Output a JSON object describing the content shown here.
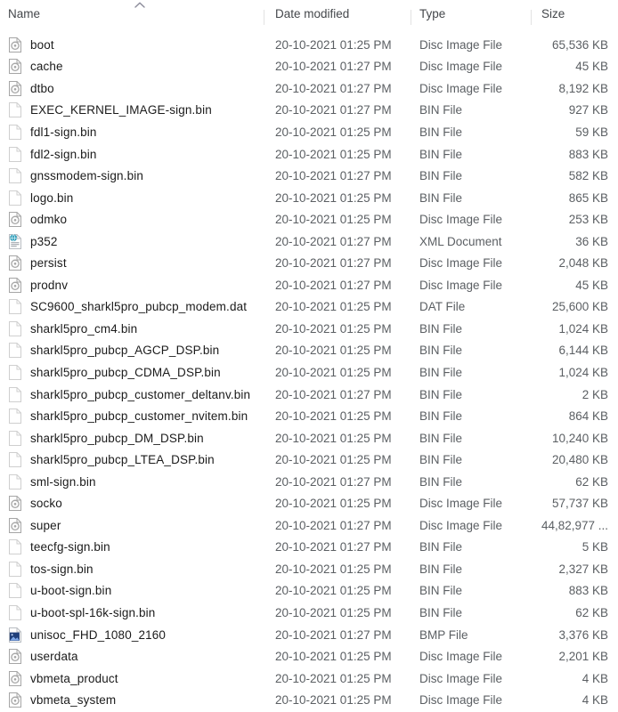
{
  "view": {
    "title": "File Explorer details view",
    "sort": {
      "column": "Name",
      "direction": "ascending",
      "indicator_icon": "chevron-up-icon"
    }
  },
  "columns": {
    "name": "Name",
    "date_modified": "Date modified",
    "type": "Type",
    "size": "Size"
  },
  "colors": {
    "text": "#1b1b1b",
    "secondary_text": "#5b5f63",
    "header_text": "#44474b",
    "divider": "#e2e2e2",
    "background": "#ffffff",
    "disc_icon": "#a6a6a6",
    "bin_icon": "#cfcfcf",
    "xml_icon": "#2b9cb8",
    "bmp_icon": "#1f3f7a"
  },
  "files": [
    {
      "name": "boot",
      "date": "20-10-2021 01:25 PM",
      "type": "Disc Image File",
      "size": "65,536 KB",
      "icon": "disc-image-file-icon"
    },
    {
      "name": "cache",
      "date": "20-10-2021 01:27 PM",
      "type": "Disc Image File",
      "size": "45 KB",
      "icon": "disc-image-file-icon"
    },
    {
      "name": "dtbo",
      "date": "20-10-2021 01:27 PM",
      "type": "Disc Image File",
      "size": "8,192 KB",
      "icon": "disc-image-file-icon"
    },
    {
      "name": "EXEC_KERNEL_IMAGE-sign.bin",
      "date": "20-10-2021 01:27 PM",
      "type": "BIN File",
      "size": "927 KB",
      "icon": "generic-file-icon"
    },
    {
      "name": "fdl1-sign.bin",
      "date": "20-10-2021 01:25 PM",
      "type": "BIN File",
      "size": "59 KB",
      "icon": "generic-file-icon"
    },
    {
      "name": "fdl2-sign.bin",
      "date": "20-10-2021 01:25 PM",
      "type": "BIN File",
      "size": "883 KB",
      "icon": "generic-file-icon"
    },
    {
      "name": "gnssmodem-sign.bin",
      "date": "20-10-2021 01:27 PM",
      "type": "BIN File",
      "size": "582 KB",
      "icon": "generic-file-icon"
    },
    {
      "name": "logo.bin",
      "date": "20-10-2021 01:25 PM",
      "type": "BIN File",
      "size": "865 KB",
      "icon": "generic-file-icon"
    },
    {
      "name": "odmko",
      "date": "20-10-2021 01:25 PM",
      "type": "Disc Image File",
      "size": "253 KB",
      "icon": "disc-image-file-icon"
    },
    {
      "name": "p352",
      "date": "20-10-2021 01:27 PM",
      "type": "XML Document",
      "size": "36 KB",
      "icon": "xml-document-icon"
    },
    {
      "name": "persist",
      "date": "20-10-2021 01:27 PM",
      "type": "Disc Image File",
      "size": "2,048 KB",
      "icon": "disc-image-file-icon"
    },
    {
      "name": "prodnv",
      "date": "20-10-2021 01:27 PM",
      "type": "Disc Image File",
      "size": "45 KB",
      "icon": "disc-image-file-icon"
    },
    {
      "name": "SC9600_sharkl5pro_pubcp_modem.dat",
      "date": "20-10-2021 01:25 PM",
      "type": "DAT File",
      "size": "25,600 KB",
      "icon": "generic-file-icon"
    },
    {
      "name": "sharkl5pro_cm4.bin",
      "date": "20-10-2021 01:25 PM",
      "type": "BIN File",
      "size": "1,024 KB",
      "icon": "generic-file-icon"
    },
    {
      "name": "sharkl5pro_pubcp_AGCP_DSP.bin",
      "date": "20-10-2021 01:25 PM",
      "type": "BIN File",
      "size": "6,144 KB",
      "icon": "generic-file-icon"
    },
    {
      "name": "sharkl5pro_pubcp_CDMA_DSP.bin",
      "date": "20-10-2021 01:25 PM",
      "type": "BIN File",
      "size": "1,024 KB",
      "icon": "generic-file-icon"
    },
    {
      "name": "sharkl5pro_pubcp_customer_deltanv.bin",
      "date": "20-10-2021 01:27 PM",
      "type": "BIN File",
      "size": "2 KB",
      "icon": "generic-file-icon"
    },
    {
      "name": "sharkl5pro_pubcp_customer_nvitem.bin",
      "date": "20-10-2021 01:25 PM",
      "type": "BIN File",
      "size": "864 KB",
      "icon": "generic-file-icon"
    },
    {
      "name": "sharkl5pro_pubcp_DM_DSP.bin",
      "date": "20-10-2021 01:25 PM",
      "type": "BIN File",
      "size": "10,240 KB",
      "icon": "generic-file-icon"
    },
    {
      "name": "sharkl5pro_pubcp_LTEA_DSP.bin",
      "date": "20-10-2021 01:25 PM",
      "type": "BIN File",
      "size": "20,480 KB",
      "icon": "generic-file-icon"
    },
    {
      "name": "sml-sign.bin",
      "date": "20-10-2021 01:27 PM",
      "type": "BIN File",
      "size": "62 KB",
      "icon": "generic-file-icon"
    },
    {
      "name": "socko",
      "date": "20-10-2021 01:25 PM",
      "type": "Disc Image File",
      "size": "57,737 KB",
      "icon": "disc-image-file-icon"
    },
    {
      "name": "super",
      "date": "20-10-2021 01:27 PM",
      "type": "Disc Image File",
      "size": "44,82,977 ...",
      "icon": "disc-image-file-icon"
    },
    {
      "name": "teecfg-sign.bin",
      "date": "20-10-2021 01:27 PM",
      "type": "BIN File",
      "size": "5 KB",
      "icon": "generic-file-icon"
    },
    {
      "name": "tos-sign.bin",
      "date": "20-10-2021 01:25 PM",
      "type": "BIN File",
      "size": "2,327 KB",
      "icon": "generic-file-icon"
    },
    {
      "name": "u-boot-sign.bin",
      "date": "20-10-2021 01:25 PM",
      "type": "BIN File",
      "size": "883 KB",
      "icon": "generic-file-icon"
    },
    {
      "name": "u-boot-spl-16k-sign.bin",
      "date": "20-10-2021 01:25 PM",
      "type": "BIN File",
      "size": "62 KB",
      "icon": "generic-file-icon"
    },
    {
      "name": "unisoc_FHD_1080_2160",
      "date": "20-10-2021 01:27 PM",
      "type": "BMP File",
      "size": "3,376 KB",
      "icon": "bmp-image-file-icon"
    },
    {
      "name": "userdata",
      "date": "20-10-2021 01:25 PM",
      "type": "Disc Image File",
      "size": "2,201 KB",
      "icon": "disc-image-file-icon"
    },
    {
      "name": "vbmeta_product",
      "date": "20-10-2021 01:25 PM",
      "type": "Disc Image File",
      "size": "4 KB",
      "icon": "disc-image-file-icon"
    },
    {
      "name": "vbmeta_system",
      "date": "20-10-2021 01:25 PM",
      "type": "Disc Image File",
      "size": "4 KB",
      "icon": "disc-image-file-icon"
    }
  ]
}
